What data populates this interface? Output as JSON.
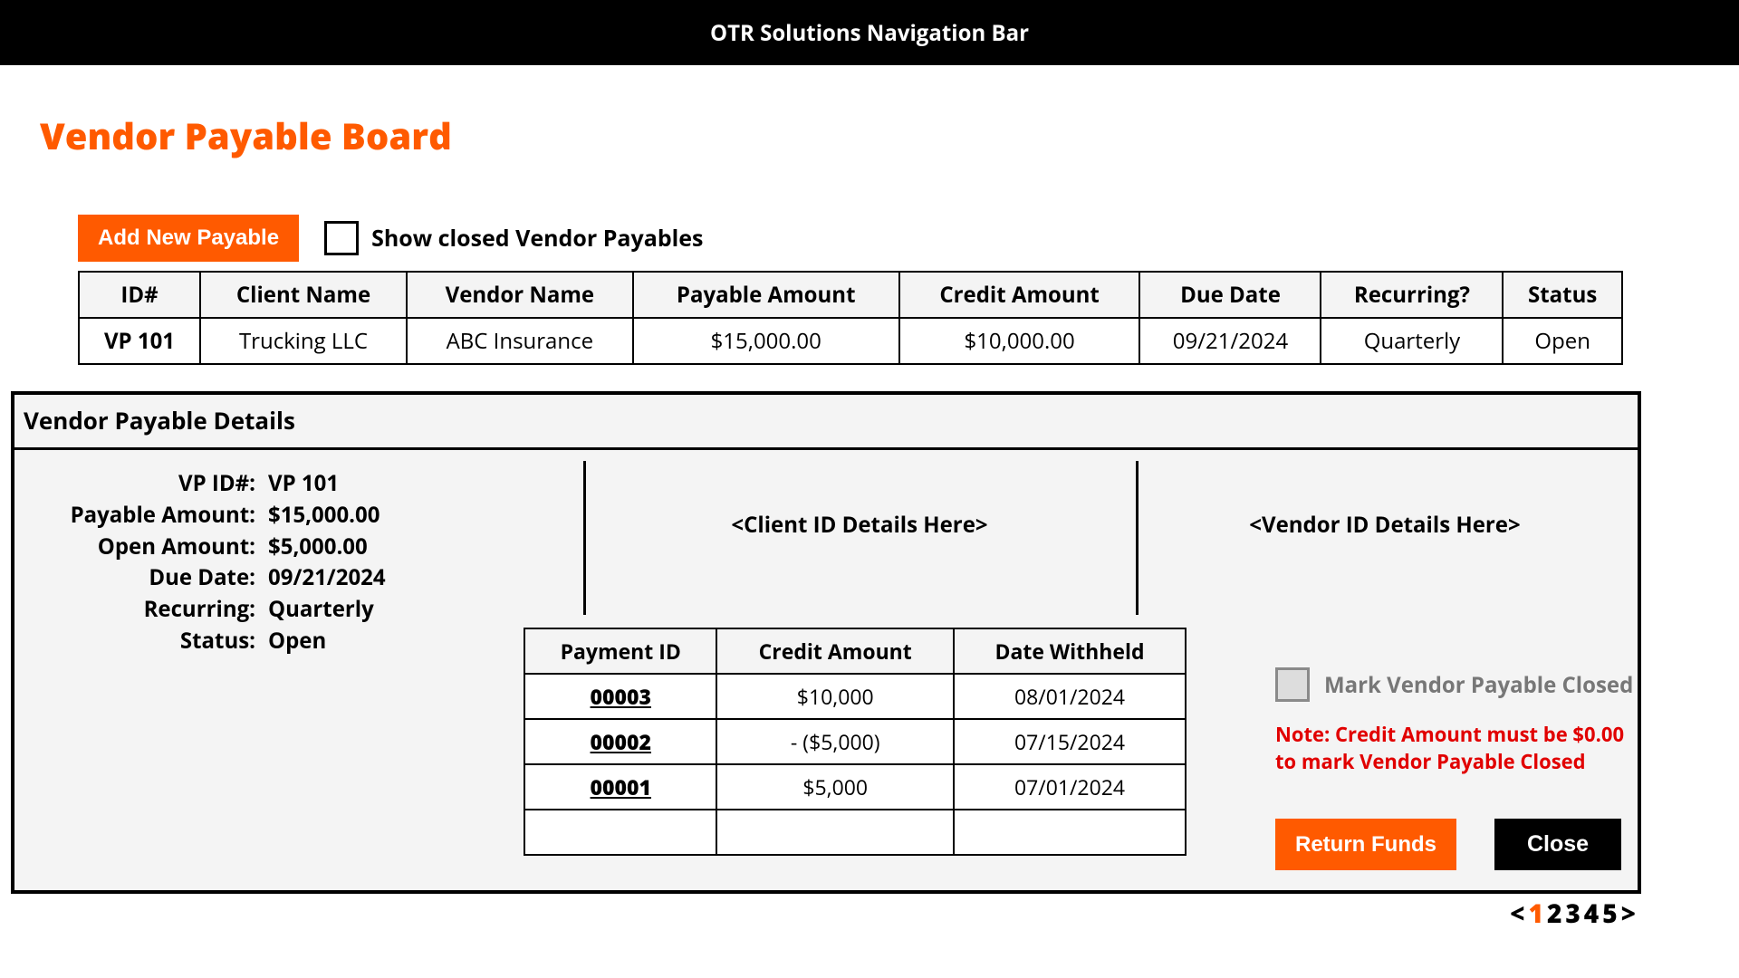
{
  "navbar": {
    "title": "OTR Solutions Navigation Bar"
  },
  "page": {
    "title": "Vendor Payable Board",
    "add_button": "Add New Payable",
    "show_closed_label": "Show closed Vendor Payables"
  },
  "table": {
    "headers": [
      "ID#",
      "Client Name",
      "Vendor Name",
      "Payable Amount",
      "Credit Amount",
      "Due Date",
      "Recurring?",
      "Status"
    ],
    "rows": [
      {
        "id": "VP 101",
        "client": "Trucking LLC",
        "vendor": "ABC Insurance",
        "payable": "$15,000.00",
        "credit": "$10,000.00",
        "due": "09/21/2024",
        "recurring": "Quarterly",
        "status": "Open"
      }
    ]
  },
  "details": {
    "title": "Vendor Payable Details",
    "fields": {
      "vp_id_label": "VP ID#:",
      "vp_id": "VP 101",
      "payable_label": "Payable Amount:",
      "payable": "$15,000.00",
      "open_label": "Open Amount:",
      "open": "$5,000.00",
      "due_label": "Due Date:",
      "due": "09/21/2024",
      "recurring_label": "Recurring:",
      "recurring": "Quarterly",
      "status_label": "Status:",
      "status": "Open"
    },
    "client_area": "<Client ID Details Here>",
    "vendor_area": "<Vendor ID Details Here>",
    "inner_headers": [
      "Payment ID",
      "Credit Amount",
      "Date Withheld"
    ],
    "inner_rows": [
      {
        "pid": "00003",
        "credit": "$10,000",
        "date": "08/01/2024"
      },
      {
        "pid": "00002",
        "credit": "- ($5,000)",
        "date": "07/15/2024"
      },
      {
        "pid": "00001",
        "credit": "$5,000",
        "date": "07/01/2024"
      }
    ],
    "mark_closed_label": "Mark Vendor Payable Closed",
    "note": "Note: Credit Amount must be $0.00 to mark Vendor Payable Closed",
    "return_funds": "Return Funds",
    "close": "Close"
  },
  "pager": {
    "prev": "<",
    "pages": [
      "1",
      "2",
      "3",
      "4",
      "5"
    ],
    "next": ">",
    "current": 0
  }
}
